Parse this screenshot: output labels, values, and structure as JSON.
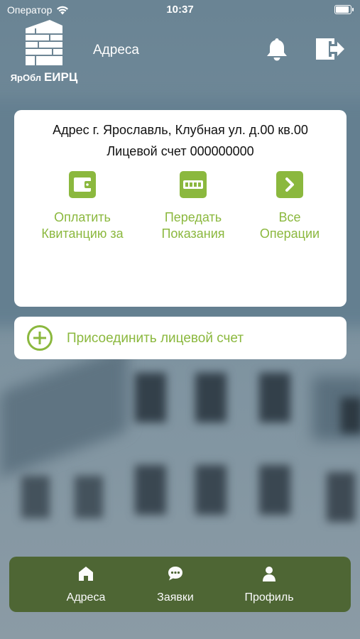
{
  "status_bar": {
    "carrier": "Оператор",
    "time": "10:37"
  },
  "header": {
    "logo_text_small": "ЯрОбл",
    "logo_text_big": "ЕИРЦ",
    "title": "Адреса"
  },
  "account_card": {
    "address": "Адрес г. Ярославль, Клубная ул. д.00 кв.00",
    "account": "Лицевой счет 000000000",
    "actions": [
      {
        "line1": "Оплатить",
        "line2": "Квитанцию за",
        "icon": "wallet-icon"
      },
      {
        "line1": "Передать",
        "line2": "Показания",
        "icon": "meter-icon"
      },
      {
        "line1": "Все",
        "line2": "Операции",
        "icon": "chevron-right-icon"
      }
    ]
  },
  "join": {
    "label": "Присоединить лицевой счет"
  },
  "tabbar": {
    "tabs": [
      {
        "label": "Адреса",
        "icon": "home-icon"
      },
      {
        "label": "Заявки",
        "icon": "chat-icon"
      },
      {
        "label": "Профиль",
        "icon": "user-icon"
      }
    ]
  },
  "colors": {
    "accent": "#8bb83e",
    "tabbar": "#4d6531"
  }
}
